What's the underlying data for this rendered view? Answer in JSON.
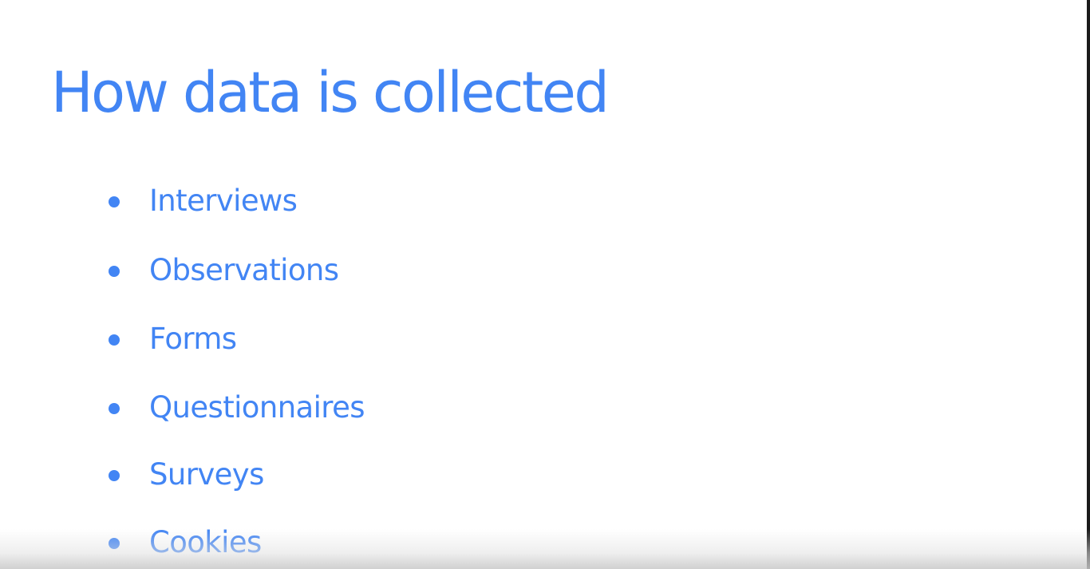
{
  "slide": {
    "title": "How data is collected",
    "bullets": [
      "Interviews",
      "Observations",
      "Forms",
      "Questionnaires",
      "Surveys",
      "Cookies"
    ]
  },
  "colors": {
    "accent": "#4285f4",
    "background": "#ffffff"
  }
}
